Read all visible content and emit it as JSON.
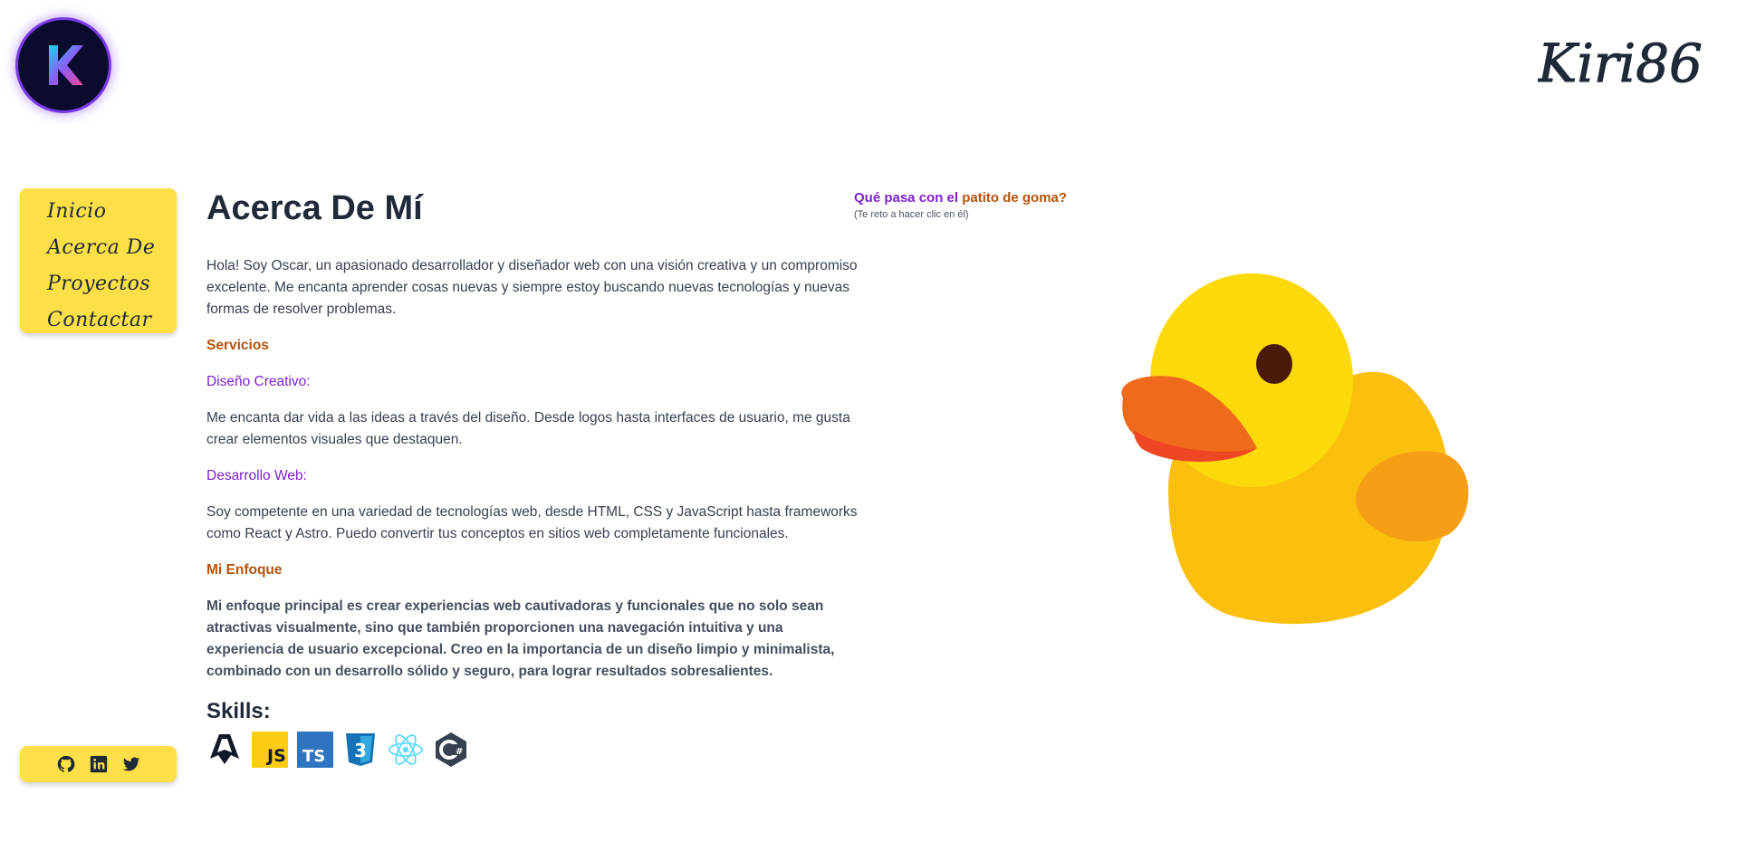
{
  "header": {
    "logo_icon": "k-logo-icon",
    "brand_text": "Kiri86"
  },
  "nav": {
    "items": [
      {
        "label": "Inicio"
      },
      {
        "label": "Acerca De"
      },
      {
        "label": "Proyectos"
      },
      {
        "label": "Contactar"
      }
    ]
  },
  "social": {
    "icons": [
      "github-icon",
      "linkedin-icon",
      "twitter-icon"
    ]
  },
  "main": {
    "title": "Acerca De Mí",
    "intro": "Hola! Soy Oscar, un apasionado desarrollador y diseñador web con una visión creativa y un compromiso excelente. Me encanta aprender cosas nuevas y siempre estoy buscando nuevas tecnologías y nuevas formas de resolver problemas.",
    "services_heading": "Servicios",
    "creative_heading": "Diseño Creativo:",
    "creative_text": "Me encanta dar vida a las ideas a través del diseño. Desde logos hasta interfaces de usuario, me gusta crear elementos visuales que destaquen.",
    "web_heading": "Desarrollo Web:",
    "web_text": "Soy competente en una variedad de tecnologías web, desde HTML, CSS y JavaScript hasta frameworks como React y Astro. Puedo convertir tus conceptos en sitios web completamente funcionales.",
    "focus_heading": "Mi Enfoque",
    "focus_text": "Mi enfoque principal es crear experiencias web cautivadoras y funcionales que no solo sean atractivas visualmente, sino que también proporcionen una navegación intuitiva y una experiencia de usuario excepcional. Creo en la importancia de un diseño limpio y minimalista, combinado con un desarrollo sólido y seguro, para lograr resultados sobresalientes.",
    "skills_title": "Skills:",
    "skills": [
      "astro-icon",
      "javascript-icon",
      "typescript-icon",
      "css3-icon",
      "react-icon",
      "csharp-icon"
    ]
  },
  "duck": {
    "question_prefix": "Qué pasa con el",
    "question_highlight": "patito de goma?",
    "hint": "(Te reto a hacer clic en él)"
  },
  "colors": {
    "accent_yellow": "#fde047",
    "purple": "#7e22ce",
    "brown": "#b45309"
  }
}
